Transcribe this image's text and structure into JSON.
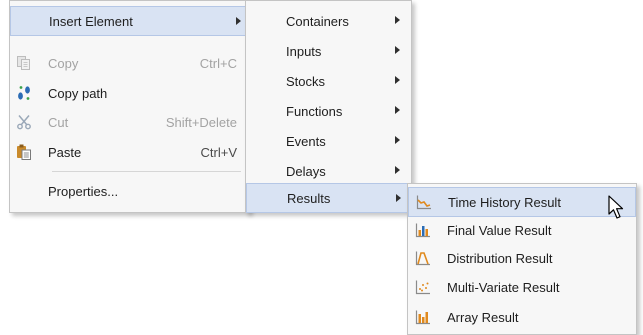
{
  "main_menu": {
    "insert_element": "Insert Element",
    "copy": "Copy",
    "copy_shortcut": "Ctrl+C",
    "copy_path": "Copy path",
    "cut": "Cut",
    "cut_shortcut": "Shift+Delete",
    "paste": "Paste",
    "paste_shortcut": "Ctrl+V",
    "properties": "Properties..."
  },
  "insert_submenu": {
    "items": [
      "Containers",
      "Inputs",
      "Stocks",
      "Functions",
      "Events",
      "Delays",
      "Results"
    ]
  },
  "results_submenu": {
    "items": [
      "Time History Result",
      "Final Value Result",
      "Distribution Result",
      "Multi-Variate Result",
      "Array Result"
    ]
  },
  "colors": {
    "highlight": "#d9e3f3",
    "highlight_border": "#b5c7e6",
    "icon_orange": "#e08a1e",
    "icon_blue": "#2b6cb5"
  }
}
